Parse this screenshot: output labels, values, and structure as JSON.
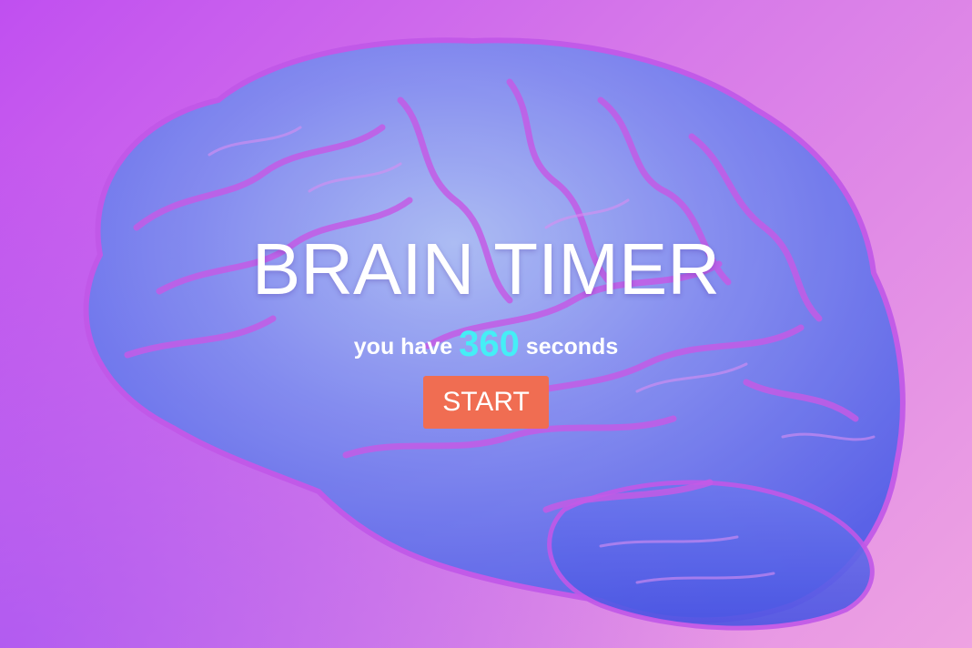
{
  "app": {
    "title": "BRAIN TIMER"
  },
  "timer": {
    "prefix": "you have",
    "seconds": "360",
    "suffix": "seconds"
  },
  "controls": {
    "start_label": "START"
  },
  "theme": {
    "background_start": "#c04ff0",
    "background_end": "#eea3e2",
    "brain_color": "#6f74ee",
    "count_color": "#45eef6",
    "button_color": "#f06d52",
    "text_color": "#ffffff"
  },
  "artwork": {
    "icon": "brain-icon"
  }
}
